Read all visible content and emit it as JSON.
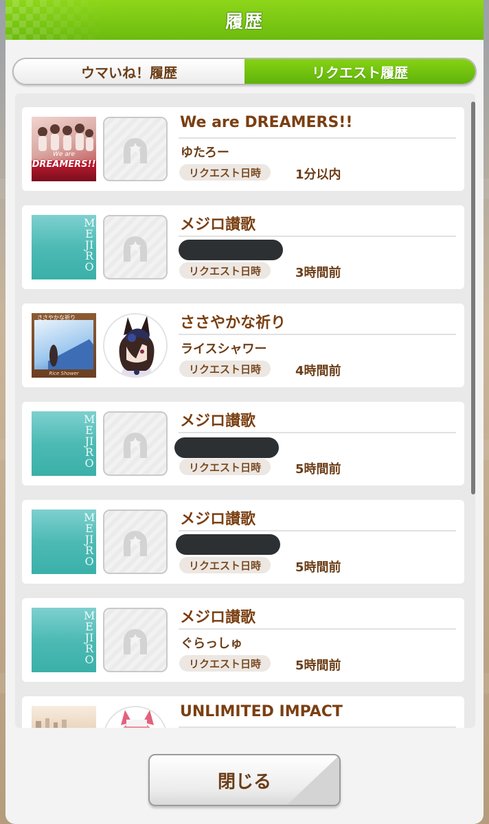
{
  "header": {
    "title": "履歴"
  },
  "tabs": [
    {
      "label": "ウマいね！履歴",
      "active": false
    },
    {
      "label": "リクエスト履歴",
      "active": true
    }
  ],
  "time_label": "リクエスト日時",
  "jackets": {
    "dreamers": {
      "line1": "We are",
      "line2": "DREAMERS!!"
    },
    "mejiro": {
      "text": "MEJIRO"
    },
    "inori": {
      "title": "ささやかな祈り",
      "sub": "Rice Shower"
    }
  },
  "requests": [
    {
      "song": "We are DREAMERS!!",
      "requester": "ゆたろー",
      "time": "1分以内"
    },
    {
      "song": "メジロ讃歌",
      "requester": "",
      "time": "3時間前"
    },
    {
      "song": "ささやかな祈り",
      "requester": "ライスシャワー",
      "time": "4時間前"
    },
    {
      "song": "メジロ讃歌",
      "requester": "",
      "time": "5時間前"
    },
    {
      "song": "メジロ讃歌",
      "requester": "",
      "time": "5時間前"
    },
    {
      "song": "メジロ讃歌",
      "requester": "ぐらっしゅ",
      "time": "5時間前"
    },
    {
      "song": "UNLIMITED IMPACT",
      "requester": "",
      "time": ""
    }
  ],
  "close_button": {
    "label": "閉じる"
  },
  "colors": {
    "accent_green": "#6cbb0e",
    "text_brown": "#7a3f12",
    "redaction": "#2c3033"
  }
}
